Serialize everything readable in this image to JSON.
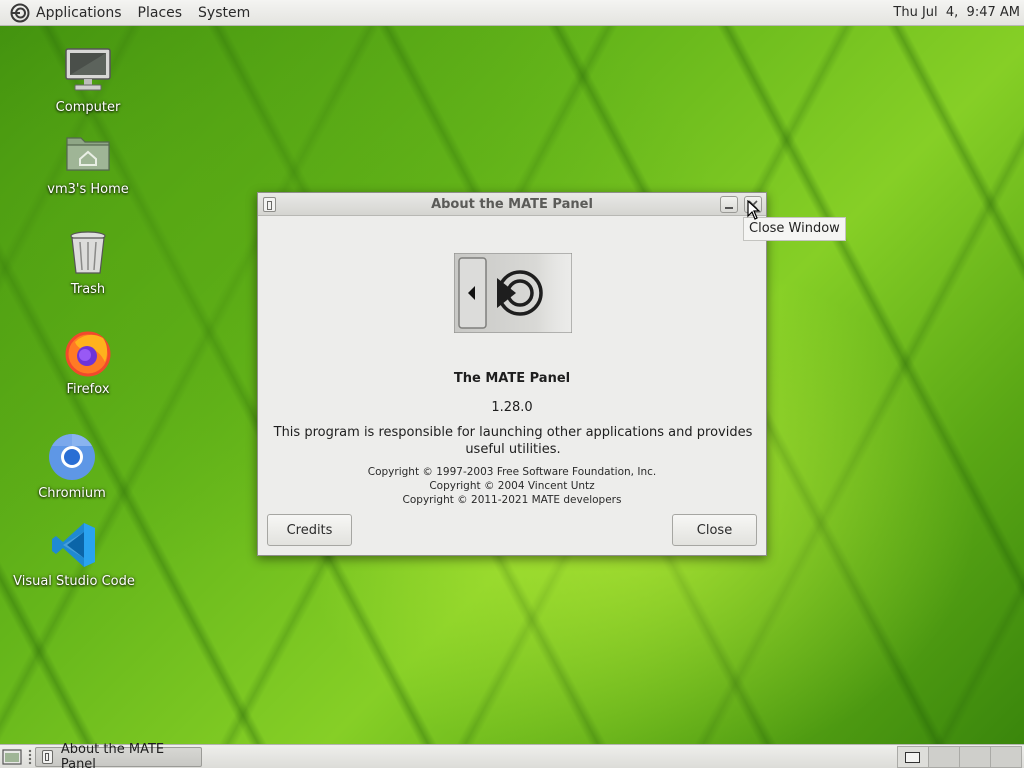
{
  "top_panel": {
    "menus": [
      "Applications",
      "Places",
      "System"
    ],
    "clock": "Thu Jul  4,  9:47 AM"
  },
  "desktop_icons": [
    {
      "label": "Computer",
      "icon": "computer-icon"
    },
    {
      "label": "vm3's Home",
      "icon": "home-folder-icon"
    },
    {
      "label": "Trash",
      "icon": "trash-icon"
    },
    {
      "label": "Firefox",
      "icon": "firefox-icon"
    },
    {
      "label": "Chromium",
      "icon": "chromium-icon"
    },
    {
      "label": "Visual Studio Code",
      "icon": "vscode-icon"
    }
  ],
  "dialog": {
    "title": "About the MATE Panel",
    "app_name": "The MATE Panel",
    "version": "1.28.0",
    "comments": "This program is responsible for launching other applications and provides useful utilities.",
    "copyright": [
      "Copyright © 1997-2003 Free Software Foundation, Inc.",
      "Copyright © 2004 Vincent Untz",
      "Copyright © 2011-2021 MATE developers"
    ],
    "credits_label": "Credits",
    "close_label": "Close"
  },
  "tooltip": "Close Window",
  "bottom_panel": {
    "task_label": "About the MATE Panel",
    "workspace_count": 4,
    "active_workspace": 1
  },
  "colors": {
    "wallpaper_green": "#64b51a",
    "panel_bg": "#e8e8e4",
    "dialog_bg": "#ededeb"
  }
}
